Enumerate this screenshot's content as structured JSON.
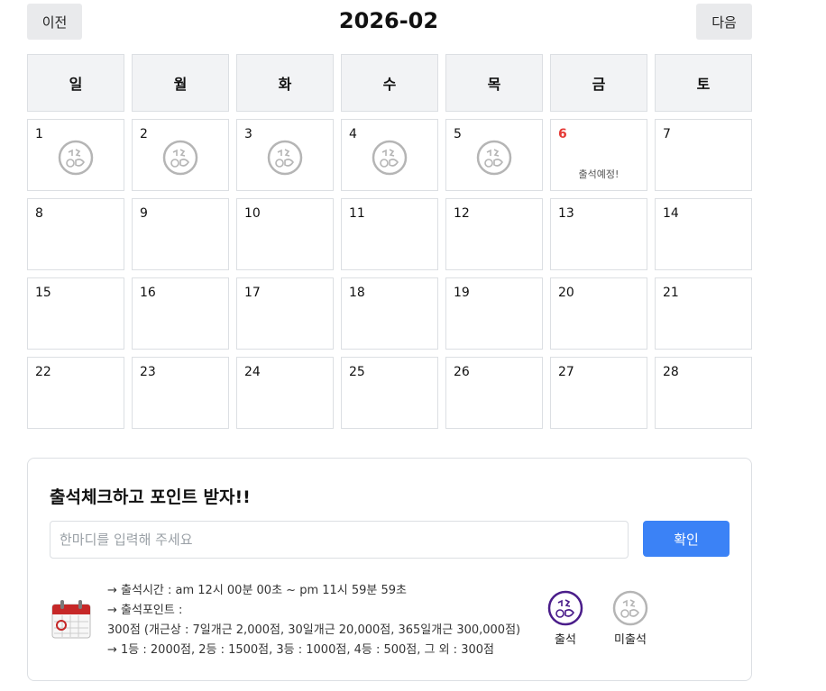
{
  "header": {
    "prev_label": "이전",
    "month": "2026-02",
    "next_label": "다음"
  },
  "weekdays": [
    "일",
    "월",
    "화",
    "수",
    "목",
    "금",
    "토"
  ],
  "days": [
    {
      "n": "1",
      "stamp": true
    },
    {
      "n": "2",
      "stamp": true
    },
    {
      "n": "3",
      "stamp": true
    },
    {
      "n": "4",
      "stamp": true
    },
    {
      "n": "5",
      "stamp": true
    },
    {
      "n": "6",
      "today": true,
      "msg": "출석예정!"
    },
    {
      "n": "7"
    },
    {
      "n": "8"
    },
    {
      "n": "9"
    },
    {
      "n": "10"
    },
    {
      "n": "11"
    },
    {
      "n": "12"
    },
    {
      "n": "13"
    },
    {
      "n": "14"
    },
    {
      "n": "15"
    },
    {
      "n": "16"
    },
    {
      "n": "17"
    },
    {
      "n": "18"
    },
    {
      "n": "19"
    },
    {
      "n": "20"
    },
    {
      "n": "21"
    },
    {
      "n": "22"
    },
    {
      "n": "23"
    },
    {
      "n": "24"
    },
    {
      "n": "25"
    },
    {
      "n": "26"
    },
    {
      "n": "27"
    },
    {
      "n": "28"
    }
  ],
  "checkin": {
    "title": "출석체크하고 포인트 받자!!",
    "placeholder": "한마디를 입력해 주세요",
    "input_value": "",
    "confirm_label": "확인",
    "info_lines": [
      "→ 출석시간 : am 12시 00분 00초 ~ pm 11시 59분 59초",
      "→ 출석포인트 :",
      "300점 (개근상 : 7일개근 2,000점, 30일개근 20,000점, 365일개근 300,000점)",
      "→ 1등 : 2000점, 2등 : 1500점, 3등 : 1000점, 4등 : 500점, 그 외 : 300점"
    ],
    "legend_attended": "출석",
    "legend_absent": "미출석"
  },
  "colors": {
    "today": "#e53935",
    "confirm": "#3b82f6",
    "attended_stamp": "#4a1d8a",
    "absent_stamp": "#b5b5b5"
  },
  "icons": {
    "calendar": "calendar-icon",
    "stamp": "attendance-stamp-icon"
  }
}
